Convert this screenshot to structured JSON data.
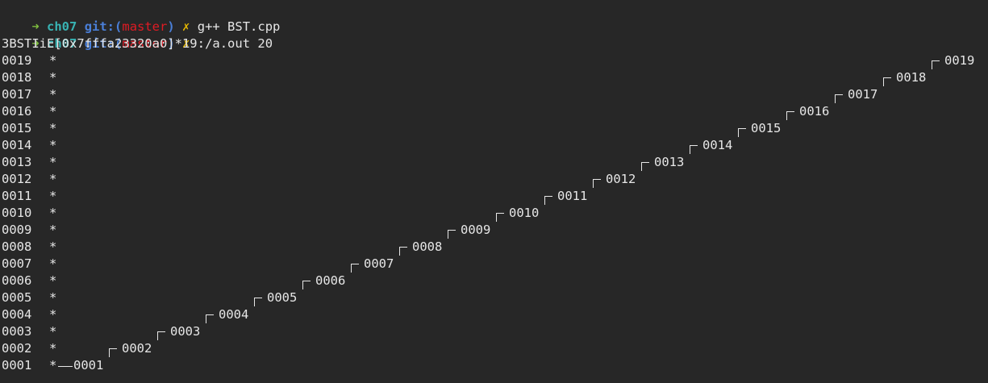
{
  "prompts": [
    {
      "arrow": "➜",
      "dir": "ch07",
      "git_open": "git:(",
      "branch": "master",
      "git_close": ")",
      "dirty": "✗",
      "command": "g++ BST.cpp"
    },
    {
      "arrow": "➜",
      "dir": "ch07",
      "git_open": "git:(",
      "branch": "master",
      "git_close": ")",
      "dirty": "✗",
      "command": "./a.out 20"
    }
  ],
  "header": "3BSTIiE[0x7fffa23320a0]*19:",
  "rows": [
    "0019",
    "0018",
    "0017",
    "0016",
    "0015",
    "0014",
    "0013",
    "0012",
    "0011",
    "0010",
    "0009",
    "0008",
    "0007",
    "0006",
    "0005",
    "0004",
    "0003",
    "0002",
    "0001"
  ],
  "row_marker": "*",
  "nodes": [
    "0001",
    "0002",
    "0003",
    "0004",
    "0005",
    "0006",
    "0007",
    "0008",
    "0009",
    "0010",
    "0011",
    "0012",
    "0013",
    "0014",
    "0015",
    "0016",
    "0017",
    "0018",
    "0019"
  ]
}
